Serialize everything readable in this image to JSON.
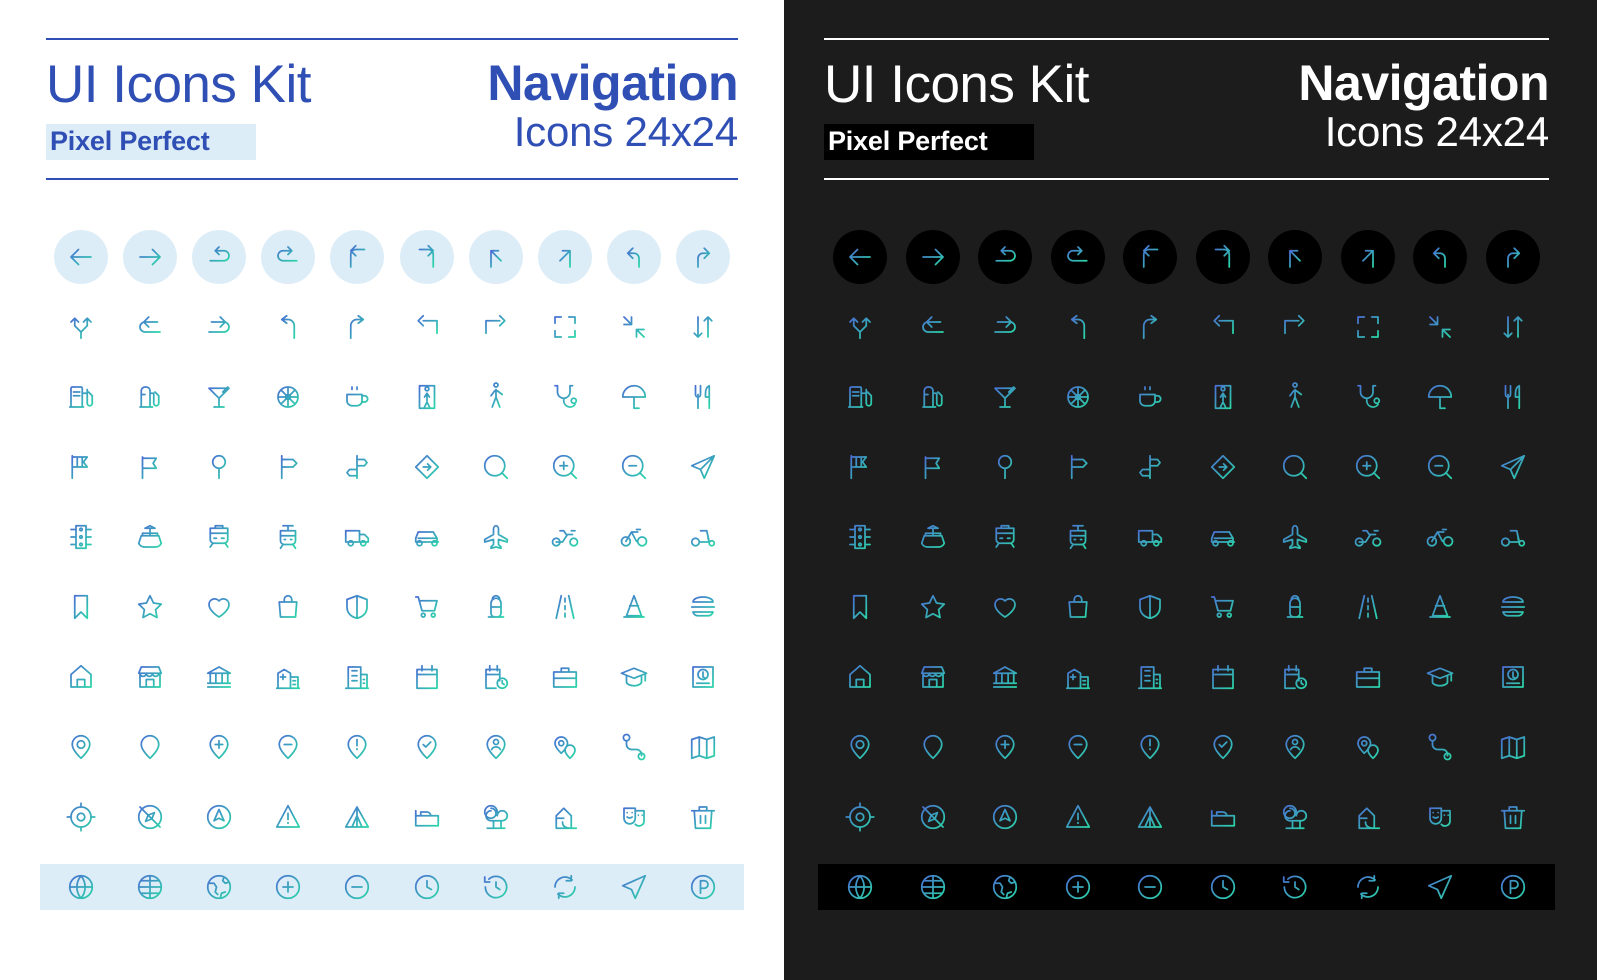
{
  "panels": [
    {
      "theme": "light",
      "kit_title": "UI Icons Kit",
      "badge": "Pixel Perfect",
      "nav_title": "Navigation",
      "nav_subtitle": "Icons 24x24",
      "colors": {
        "background": "#ffffff",
        "text": "#2f4fb5",
        "badge_background": "#ddedf7",
        "rule": "#2f4fb5",
        "icon_circle": "#ddedf7",
        "gradient_start": "#4a6fd4",
        "gradient_end": "#2ad6a8"
      }
    },
    {
      "theme": "dark",
      "kit_title": "UI Icons Kit",
      "badge": "Pixel Perfect",
      "nav_title": "Navigation",
      "nav_subtitle": "Icons 24x24",
      "colors": {
        "background": "#1c1c1c",
        "text": "#ffffff",
        "badge_background": "#000000",
        "rule": "#ffffff",
        "icon_circle": "#000000",
        "gradient_start": "#4a6fd4",
        "gradient_end": "#2ad6a8"
      }
    }
  ],
  "icon_rows": [
    {
      "style": "circled",
      "icons": [
        "arrow-left-icon",
        "arrow-right-icon",
        "undo-arrow-icon",
        "redo-arrow-icon",
        "turn-up-left-icon",
        "turn-up-right-icon",
        "arrow-slant-up-left-icon",
        "arrow-slant-up-right-icon",
        "turn-sharp-left-icon",
        "turn-sharp-right-icon"
      ]
    },
    {
      "style": "plain",
      "icons": [
        "fork-road-icon",
        "u-turn-left-icon",
        "u-turn-right-icon",
        "merge-left-icon",
        "merge-right-icon",
        "arrow-corner-left-icon",
        "arrow-corner-right-icon",
        "expand-fullscreen-icon",
        "collapse-fullscreen-icon",
        "swap-vertical-icon"
      ]
    },
    {
      "style": "plain",
      "icons": [
        "gas-station-icon",
        "fuel-pump-icon",
        "bar-cocktail-icon",
        "ferris-wheel-icon",
        "coffee-cup-icon",
        "elevator-icon",
        "pedestrian-icon",
        "stethoscope-icon",
        "beach-umbrella-icon",
        "restaurant-cutlery-icon"
      ]
    },
    {
      "style": "plain",
      "icons": [
        "flag-checkered-icon",
        "flag-icon",
        "balloon-marker-icon",
        "signpost-single-icon",
        "signpost-double-icon",
        "direction-diamond-icon",
        "magnifier-icon",
        "zoom-in-icon",
        "zoom-out-icon",
        "paper-plane-icon"
      ]
    },
    {
      "style": "plain",
      "icons": [
        "traffic-light-icon",
        "ship-icon",
        "train-icon",
        "tram-icon",
        "van-icon",
        "car-icon",
        "airplane-icon",
        "motorcycle-icon",
        "bicycle-icon",
        "scooter-icon"
      ]
    },
    {
      "style": "plain",
      "icons": [
        "bookmark-icon",
        "star-icon",
        "heart-icon",
        "shopping-bag-icon",
        "shield-icon",
        "shopping-cart-icon",
        "fire-hydrant-icon",
        "road-icon",
        "traffic-cone-icon",
        "burger-icon"
      ]
    },
    {
      "style": "plain",
      "icons": [
        "home-icon",
        "store-icon",
        "bank-icon",
        "hospital-icon",
        "office-building-icon",
        "calendar-icon",
        "calendar-clock-icon",
        "briefcase-icon",
        "graduation-cap-icon",
        "atm-icon"
      ]
    },
    {
      "style": "plain",
      "icons": [
        "map-pin-icon",
        "map-pin-filled-icon",
        "map-pin-plus-icon",
        "map-pin-minus-icon",
        "map-pin-alert-icon",
        "map-pin-check-icon",
        "map-pin-user-icon",
        "map-pin-multiple-icon",
        "route-icon",
        "folded-map-icon"
      ]
    },
    {
      "style": "plain",
      "icons": [
        "target-locate-icon",
        "compass-off-icon",
        "navigation-circle-icon",
        "warning-triangle-icon",
        "tent-icon",
        "bed-icon",
        "park-tree-icon",
        "playground-slide-icon",
        "theater-masks-icon",
        "trash-bin-icon"
      ]
    },
    {
      "style": "banded",
      "icons": [
        "globe-icon",
        "globe-grid-icon",
        "globe-earth-icon",
        "plus-circle-icon",
        "minus-circle-icon",
        "clock-icon",
        "clock-history-icon",
        "refresh-icon",
        "navigation-arrow-icon",
        "parking-icon"
      ]
    }
  ]
}
